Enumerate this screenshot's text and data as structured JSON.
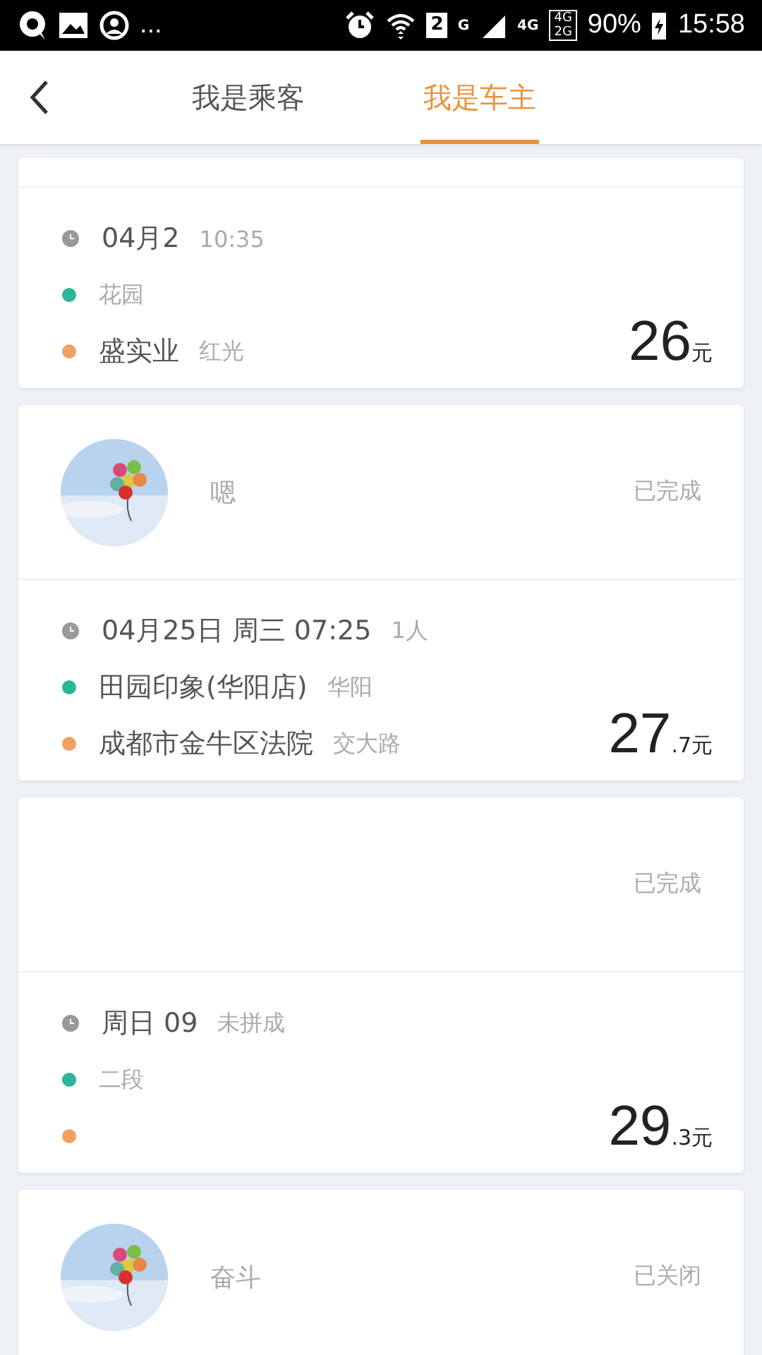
{
  "status_bar": {
    "left_more": "...",
    "sim_slot": "2",
    "network_g": "G",
    "network_4g": "4G",
    "dual_top": "4G",
    "dual_bottom": "2G",
    "battery": "90%",
    "time": "15:58"
  },
  "tabs": [
    {
      "label": "我是乘客",
      "selected": false
    },
    {
      "label": "我是车主",
      "selected": true
    }
  ],
  "trips": [
    {
      "rows": [
        {
          "kind": "time",
          "main": "04月2",
          "extra": "10:35"
        },
        {
          "kind": "place",
          "color": "#2bb59a",
          "main": "",
          "extra": "花园"
        },
        {
          "kind": "place",
          "color": "#f0a060",
          "main": "盛实业",
          "extra": "红光"
        }
      ],
      "price": "26",
      "price_suffix": "元"
    },
    {
      "avatar": {
        "kind": "picture"
      },
      "name": "嗯",
      "status": "已完成",
      "rows": [
        {
          "kind": "time",
          "main": "04月25日 周三 07:25",
          "extra": "1人"
        },
        {
          "kind": "place",
          "color": "#2bb59a",
          "main": "田园印象(华阳店)",
          "extra": "华阳"
        },
        {
          "kind": "place",
          "color": "#f0a060",
          "main": "成都市金牛区法院",
          "extra": "交大路"
        }
      ],
      "price": "27",
      "price_suffix": ".7元"
    },
    {
      "status": "已完成",
      "rows": [
        {
          "kind": "time",
          "main": "周日 09",
          "extra": "未拼成"
        },
        {
          "kind": "place",
          "color": "#2bb59a",
          "main": "",
          "extra": "二段"
        },
        {
          "kind": "place",
          "color": "#f0a060",
          "main": "",
          "extra": ""
        }
      ],
      "price": "29",
      "price_suffix": ".3元"
    },
    {
      "avatar": {
        "kind": "picture"
      },
      "name": "奋斗",
      "status": "已关闭"
    }
  ]
}
